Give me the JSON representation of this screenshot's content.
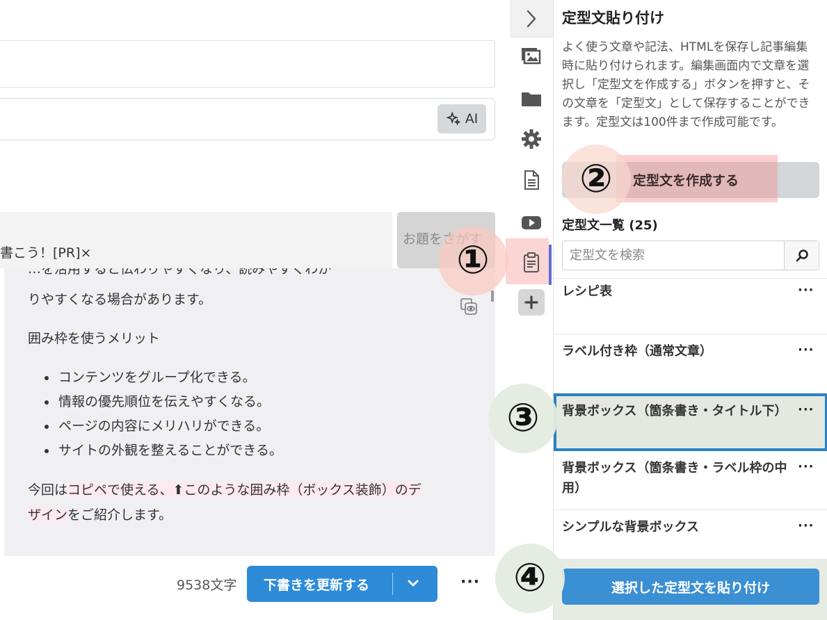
{
  "editor": {
    "ai_label": "AI",
    "tag_text": "書こう！[PR]×",
    "odai_label": "お題をさがす",
    "content": {
      "cut_line": "…を活用すると伝わりやすくなり、読みやすくわか",
      "line1": "りやすくなる場合があります。",
      "line2": "囲み枠を使うメリット",
      "bullets": [
        "コンテンツをグループ化できる。",
        "情報の優先順位を伝えやすくなる。",
        "ページの内容にメリハリができる。",
        "サイトの外観を整えることができる。"
      ],
      "para_a": "今回は",
      "para_hl1": "コピペで使える、⬆このような囲み枠（ボックス装飾）のデ",
      "para_hl2": "ザイン",
      "para_b": "をご紹介します。"
    },
    "char_count": "9538文字",
    "update_label": "下書きを更新する",
    "more_label": "···"
  },
  "rail": {
    "items": [
      "image-icon",
      "folder-icon",
      "gear-icon",
      "document-icon",
      "youtube-icon",
      "clipboard-icon",
      "plus-icon"
    ]
  },
  "panel": {
    "title": "定型文貼り付け",
    "description": "よく使う文章や記法、HTMLを保存し記事編集時に貼り付けられます。編集画面内で文章を選択し「定型文を作成する」ボタンを押すと、その文章を「定型文」として保存することができます。定型文は100件まで作成可能です。",
    "create_label": "定型文を作成する",
    "list_title": "定型文一覧 (25)",
    "search_placeholder": "定型文を検索",
    "items": [
      {
        "name": "レシピ表",
        "dots": "···"
      },
      {
        "name": "ラベル付き枠（通常文章）",
        "dots": "···"
      },
      {
        "name": "背景ボックス（箇条書き・タイトル下）",
        "dots": "···"
      },
      {
        "name": "背景ボックス（箇条書き・ラベル枠の中用）",
        "dots": "···"
      },
      {
        "name": "シンプルな背景ボックス",
        "dots": "···"
      }
    ],
    "paste_label": "選択した定型文を貼り付け"
  },
  "callouts": [
    "①",
    "②",
    "③",
    "④"
  ],
  "colors": {
    "primary": "#2e8bd8",
    "selected_border": "#2b82c2",
    "selected_bg": "#e3e9e1",
    "active_rail": "#fbd4d4",
    "highlight": "#fde9ee"
  }
}
